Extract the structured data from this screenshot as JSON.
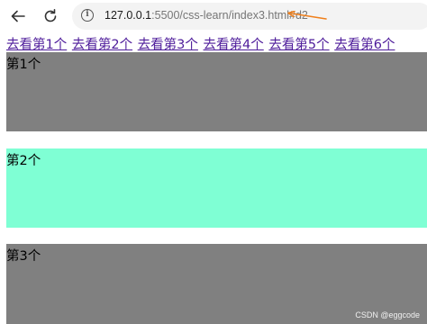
{
  "browser": {
    "url_host": "127.0.0.1",
    "url_rest": ":5500/css-learn/index3.html#d2",
    "annotation_color": "#f07f1a"
  },
  "page": {
    "links": [
      "去看第1个",
      "去看第2个",
      "去看第3个",
      "去看第4个",
      "去看第5个",
      "去看第6个"
    ],
    "boxes": [
      {
        "label": "第1个",
        "color": "#808080"
      },
      {
        "label": "第2个",
        "color": "#7fffd4"
      },
      {
        "label": "第3个",
        "color": "#808080"
      }
    ]
  },
  "watermark": "CSDN @eggcode"
}
